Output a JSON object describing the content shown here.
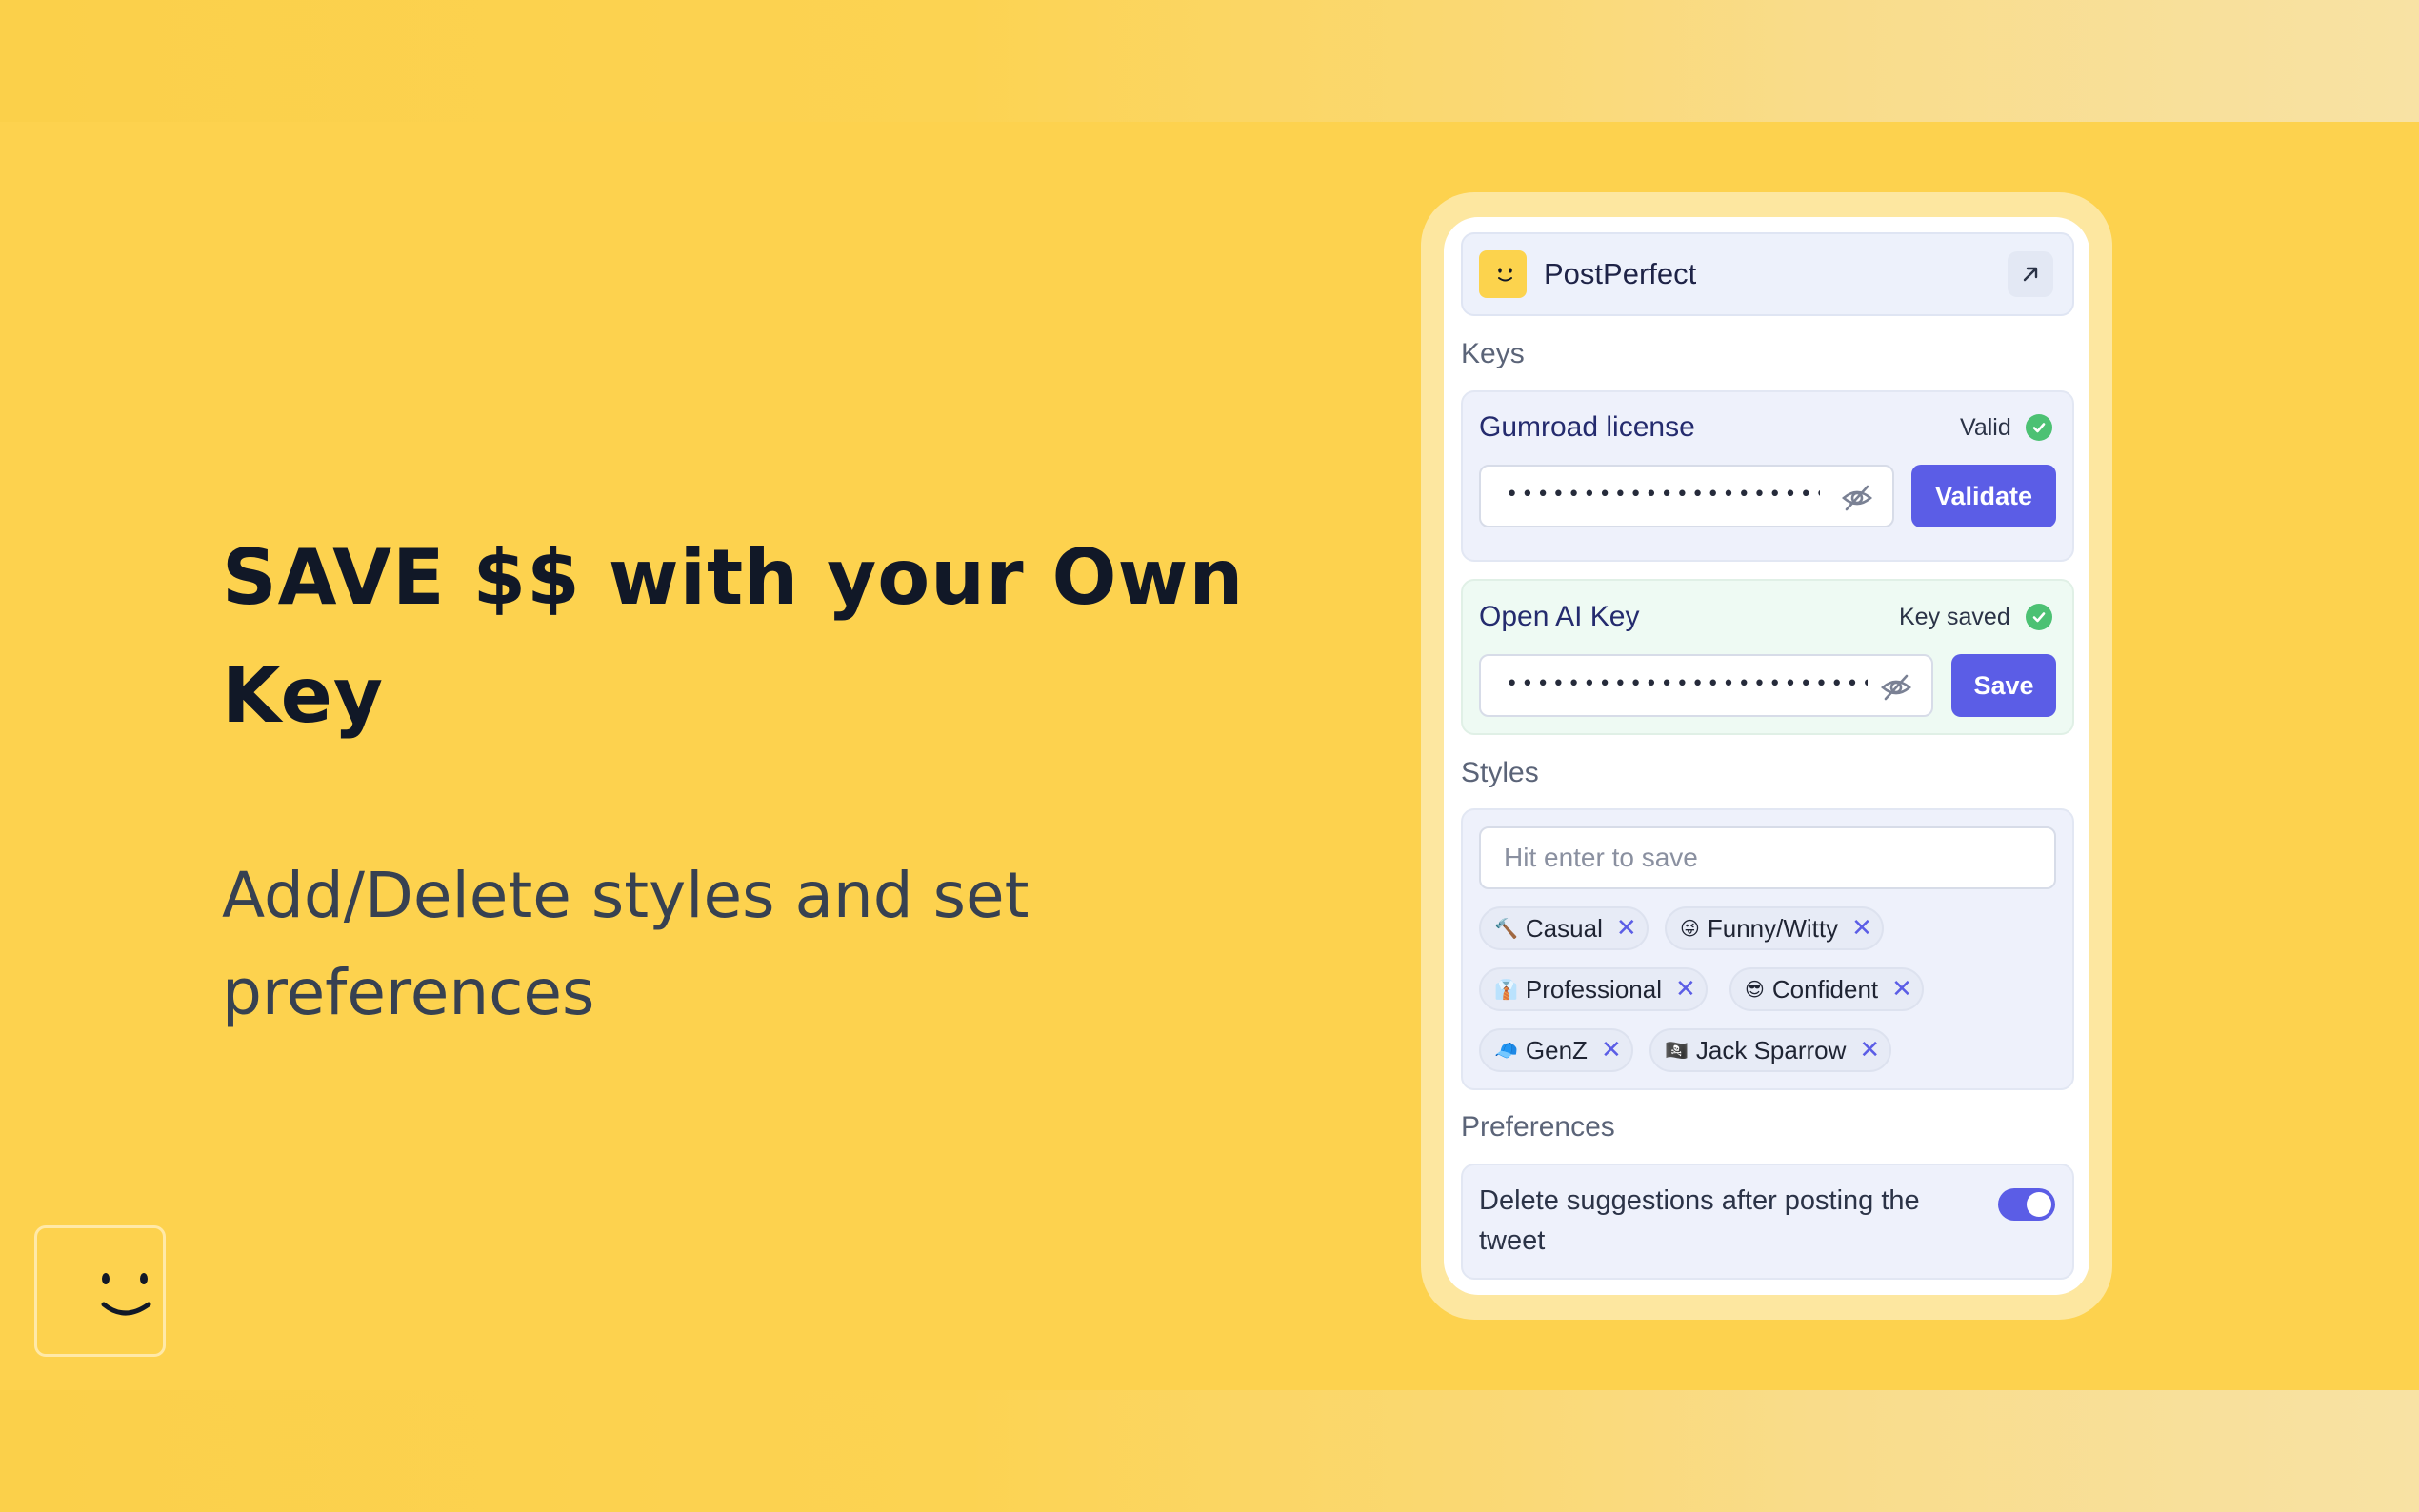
{
  "hero": {
    "headline": "SAVE $$ with your Own Key",
    "subline": "Add/Delete styles and set preferences"
  },
  "popup": {
    "app_title": "PostPerfect",
    "keys_label": "Keys",
    "gumroad": {
      "label": "Gumroad license",
      "status": "Valid",
      "masked_value": "••••••••••••••••••••••••",
      "button": "Validate"
    },
    "openai": {
      "label": "Open AI Key",
      "status": "Key saved",
      "masked_value": "••••••••••••••••••••••••••••",
      "button": "Save"
    },
    "styles_label": "Styles",
    "styles_input_placeholder": "Hit enter to save",
    "styles": [
      {
        "emoji": "🔨",
        "label": "Casual"
      },
      {
        "emoji": "😜",
        "label": "Funny/Witty"
      },
      {
        "emoji": "👔",
        "label": "Professional"
      },
      {
        "emoji": "😎",
        "label": "Confident"
      },
      {
        "emoji": "🧢",
        "label": "GenZ"
      },
      {
        "emoji": "🏴‍☠️",
        "label": "Jack Sparrow"
      }
    ],
    "remove_glyph": "✕",
    "preferences_label": "Preferences",
    "preference": {
      "text": "Delete suggestions after posting the tweet",
      "enabled": true
    }
  },
  "colors": {
    "background": "#fdd24e",
    "accent": "#5b5de6",
    "success": "#4cc173"
  }
}
